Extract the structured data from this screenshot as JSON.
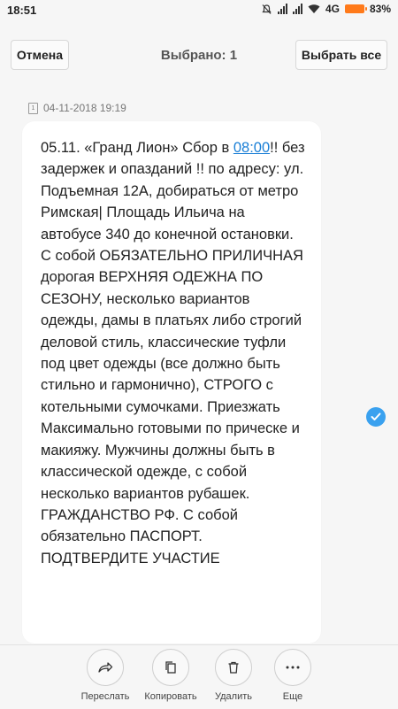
{
  "status_bar": {
    "time": "18:51",
    "network": "4G",
    "battery": "83%"
  },
  "header": {
    "cancel_label": "Отмена",
    "title": "Выбрано: 1",
    "select_all_label": "Выбрать все"
  },
  "message": {
    "timestamp": "04-11-2018 19:19",
    "sim_label": "1",
    "pre_link": "05.11. «Гранд Лион» Сбор в ",
    "link": "08:00",
    "post_link": "!! без задержек и опазданий !! по адресу: ул. Подъемная 12А, добираться от метро Римская| Площадь Ильича на автобусе 340 до конечной остановки. С собой ОБЯЗАТЕЛЬНО ПРИЛИЧНАЯ дорогая ВЕРХНЯЯ ОДЕЖНА ПО СЕЗОНУ, несколько вариантов одежды, дамы в платьях либо строгий деловой стиль, классические туфли под цвет одежды (все должно быть стильно и гармонично), СТРОГО с котельными сумочками. Приезжать Максимально готовыми по прическе и макияжу. Мужчины должны быть в классической одежде, с собой несколько вариантов рубашек. ГРАЖДАНСТВО РФ. С собой обязательно ПАСПОРТ. ПОДТВЕРДИТЕ УЧАСТИЕ"
  },
  "actions": [
    {
      "label": "Переслать",
      "icon": "forward-icon"
    },
    {
      "label": "Копировать",
      "icon": "copy-icon"
    },
    {
      "label": "Удалить",
      "icon": "trash-icon"
    },
    {
      "label": "Еще",
      "icon": "more-icon"
    }
  ],
  "colors": {
    "accent": "#3aa1ef",
    "link": "#1a7fd6",
    "battery": "#ff7a1a"
  }
}
